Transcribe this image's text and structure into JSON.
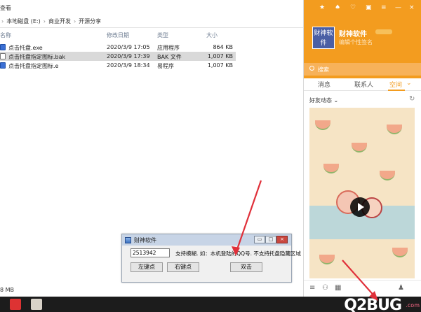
{
  "explorer": {
    "menu_label": "查看",
    "breadcrumb": [
      "本地磁盘 (E:)",
      "商业开发",
      "开源分享"
    ],
    "columns": [
      "名称",
      "修改日期",
      "类型",
      "大小"
    ],
    "files": [
      {
        "name": "点击托盘.exe",
        "date": "2020/3/9 17:05",
        "type": "应用程序",
        "size": "864 KB",
        "icon": "exe",
        "selected": false
      },
      {
        "name": "点击托盘指定图标.bak",
        "date": "2020/3/9 17:39",
        "type": "BAK 文件",
        "size": "1,007 KB",
        "icon": "bak",
        "selected": true
      },
      {
        "name": "点击托盘指定图标.e",
        "date": "2020/3/9 18:34",
        "type": "易程序",
        "size": "1,007 KB",
        "icon": "e",
        "selected": false
      }
    ],
    "status": "8 MB"
  },
  "dialog": {
    "title": "财神软件",
    "input_value": "2513942",
    "hint": "支持模糊. 如：本机登陆的QQ号. 不支持托盘隐藏区域",
    "buttons": [
      "左键点",
      "右键点",
      "双击"
    ]
  },
  "qq": {
    "avatar_text": "财神软件",
    "nickname": "财神软件",
    "signature": "编辑个性签名",
    "search_placeholder": "搜索",
    "tabs": [
      "消息",
      "联系人",
      "空间"
    ],
    "active_tab": "空间",
    "feed_header": "好友动态",
    "accent": "#f39c1f"
  },
  "taskbar": {
    "watermark": "Q2BUG",
    "watermark_small": ".com"
  }
}
